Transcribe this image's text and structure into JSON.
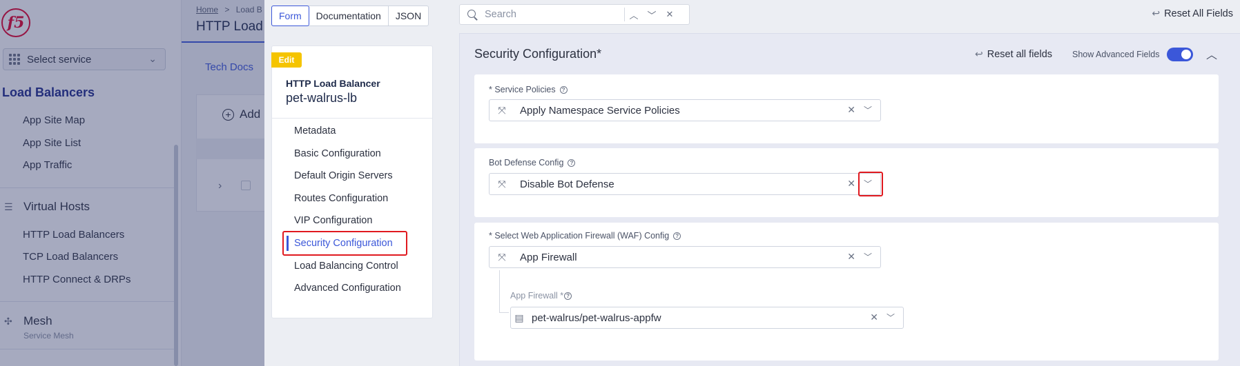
{
  "background": {
    "select_service": "Select service",
    "section": "Load Balancers",
    "links_top": [
      "App Site Map",
      "App Site List",
      "App Traffic"
    ],
    "virtual_hosts": {
      "label": "Virtual Hosts",
      "items": [
        "HTTP Load Balancers",
        "TCP Load Balancers",
        "HTTP Connect & DRPs"
      ]
    },
    "mesh": {
      "label": "Mesh",
      "sub": "Service Mesh"
    },
    "breadcrumb_home": "Home",
    "breadcrumb_sep": ">",
    "breadcrumb_current": "Load B",
    "page_title": "HTTP Load",
    "tech_docs": "Tech Docs",
    "add_label": "Add"
  },
  "modes": {
    "form": "Form",
    "documentation": "Documentation",
    "json": "JSON"
  },
  "nav": {
    "badge": "Edit",
    "type": "HTTP Load Balancer",
    "name": "pet-walrus-lb",
    "items": [
      "Metadata",
      "Basic Configuration",
      "Default Origin Servers",
      "Routes Configuration",
      "VIP Configuration",
      "Security Configuration",
      "Load Balancing Control",
      "Advanced Configuration"
    ],
    "active_index": 5
  },
  "search": {
    "placeholder": "Search",
    "up": "▲",
    "down": "▼",
    "close": "✕"
  },
  "reset_all_fields": "Reset All Fields",
  "section": {
    "title": "Security Configuration*",
    "reset": "Reset all fields",
    "show_advanced": "Show Advanced Fields",
    "show_advanced_on": true
  },
  "fields": {
    "service_policies": {
      "label": "* Service Policies",
      "value": "Apply Namespace Service Policies"
    },
    "bot_defense": {
      "label": "Bot Defense Config",
      "value": "Disable Bot Defense"
    },
    "waf": {
      "label": "* Select Web Application Firewall (WAF) Config",
      "value": "App Firewall"
    },
    "app_firewall": {
      "label": "App Firewall *",
      "value": "pet-walrus/pet-walrus-appfw"
    }
  },
  "colors": {
    "accent": "#3b57d9",
    "highlight": "#e0191f",
    "badge": "#f5c400",
    "brand": "#e4002b"
  }
}
